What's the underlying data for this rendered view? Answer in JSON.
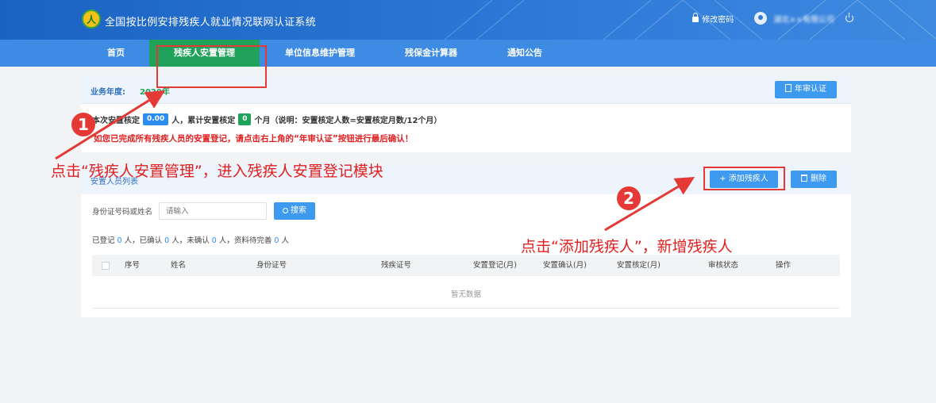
{
  "header": {
    "app_title": "全国按比例安排残疾人就业情况联网认证系统",
    "logo_char": "人",
    "change_password": "修改密码",
    "company_name": "湖北××有限公司"
  },
  "nav": {
    "items": [
      "首页",
      "残疾人安置管理",
      "单位信息维护管理",
      "残保金计算器",
      "通知公告"
    ],
    "active_index": 1,
    "active_color": "#1fa35a"
  },
  "summary": {
    "year_label": "业务年度:",
    "year_value": "2020年",
    "annual_button": "年审认证",
    "line_a": "本次安置核定",
    "count_value": "0.00",
    "line_b": "人，累计安置核定",
    "months_value": "0",
    "line_c": "个月（说明：安置核定人数=安置核定月数/12个月）",
    "warning": "如您已完成所有残疾人员的安置登记，请点击右上角的“年审认证”按钮进行最后确认！"
  },
  "list": {
    "title": "安置人员列表",
    "add_button": "添加残疾人",
    "delete_button": "删除",
    "search_label": "身份证号码或姓名",
    "search_placeholder": "请输入",
    "search_button": "搜索",
    "stats": {
      "registered_label": "已登记",
      "registered": "0",
      "confirmed_label": "人，已确认",
      "confirmed": "0",
      "unconfirmed_label": "人，未确认",
      "unconfirmed": "0",
      "pending_label": "人，资料待完善",
      "pending": "0",
      "unit": "人"
    },
    "columns": [
      "序号",
      "姓名",
      "身份证号",
      "残疾证号",
      "安置登记(月)",
      "安置确认(月)",
      "安置核定(月)",
      "审核状态",
      "操作"
    ],
    "empty_text": "暂无数据"
  },
  "annotations": {
    "step1_number": "1",
    "step1_text": "点击“残疾人安置管理”，进入残疾人安置登记模块",
    "step2_number": "2",
    "step2_text": "点击“添加残疾人”，新增残疾人",
    "color": "#e53935"
  }
}
